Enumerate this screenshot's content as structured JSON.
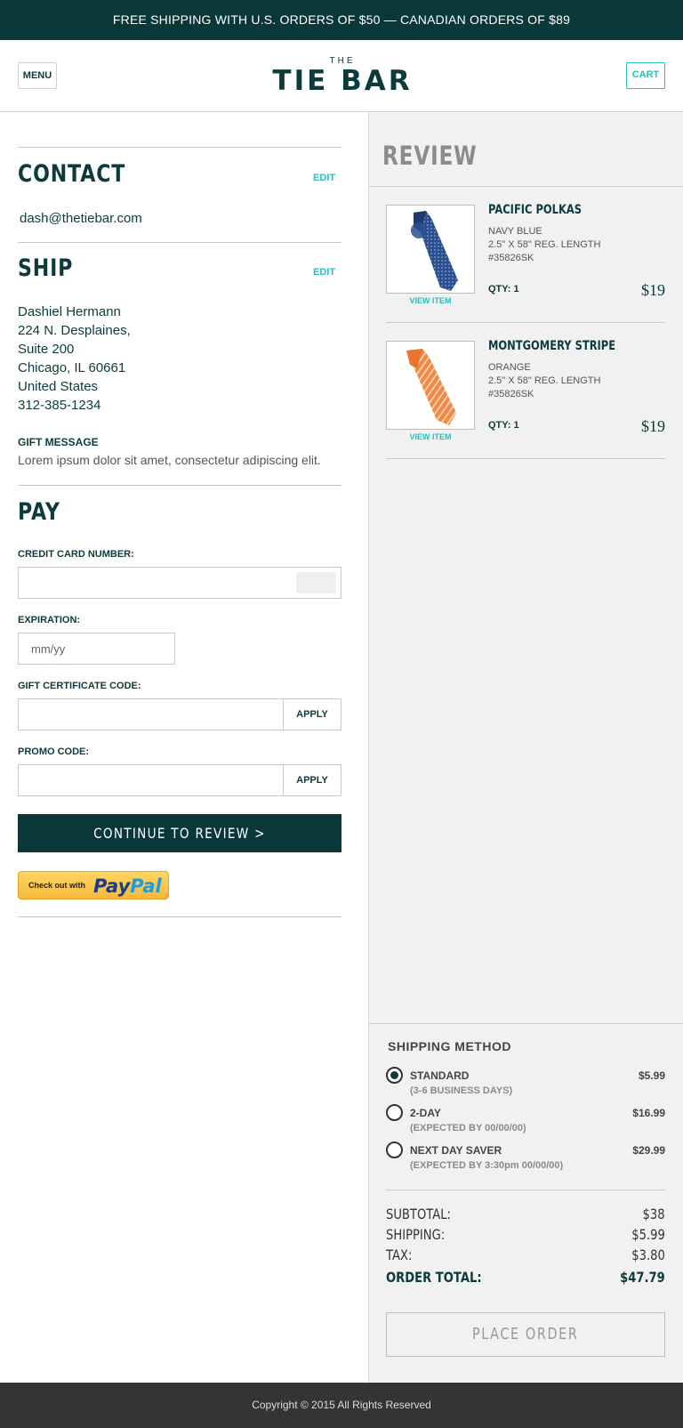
{
  "banner": {
    "text": "FREE SHIPPING WITH U.S. ORDERS OF $50 — CANADIAN ORDERS OF $89"
  },
  "header": {
    "menu_label": "MENU",
    "logo_top": "THE",
    "logo_main": "TIE BAR",
    "cart_label": "CART"
  },
  "contact": {
    "title": "CONTACT",
    "edit_label": "EDIT",
    "email": "dash@thetiebar.com"
  },
  "ship": {
    "title": "SHIP",
    "edit_label": "EDIT",
    "address_lines": [
      "Dashiel Hermann",
      "224 N. Desplaines,",
      "Suite 200",
      "Chicago, IL 60661",
      "United States",
      "312-385-1234"
    ],
    "gift_label": "GIFT MESSAGE",
    "gift_text": "Lorem ipsum dolor sit amet, consectetur adipiscing elit."
  },
  "pay": {
    "title": "PAY",
    "card_label": "CREDIT CARD NUMBER:",
    "card_value": "",
    "exp_label": "EXPIRATION:",
    "exp_placeholder": "mm/yy",
    "gift_cert_label": "GIFT CERTIFICATE CODE:",
    "promo_label": "PROMO CODE:",
    "apply_label": "APPLY",
    "continue_label": "CONTINUE TO REVIEW >",
    "paypal_small": "Check out with",
    "paypal_pay": "Pay",
    "paypal_pal": "Pal"
  },
  "review": {
    "title": "REVIEW",
    "view_item_label": "VIEW ITEM",
    "items": [
      {
        "name": "PACIFIC POLKAS",
        "color": "NAVY BLUE",
        "size": "2.5\" X 58\" REG. LENGTH",
        "sku": "#35826SK",
        "qty": "QTY: 1",
        "price": "$19",
        "tie_color": "#2b4f8e"
      },
      {
        "name": "MONTGOMERY STRIPE",
        "color": "ORANGE",
        "size": "2.5\" X 58\" REG. LENGTH",
        "sku": "#35826SK",
        "qty": "QTY: 1",
        "price": "$19",
        "tie_color": "#f28a45"
      }
    ]
  },
  "shipping": {
    "title": "SHIPPING METHOD",
    "options": [
      {
        "name": "STANDARD",
        "sub": "(3-6 BUSINESS DAYS)",
        "price": "$5.99",
        "selected": true
      },
      {
        "name": "2-DAY",
        "sub": "(EXPECTED BY 00/00/00)",
        "price": "$16.99",
        "selected": false
      },
      {
        "name": "NEXT DAY SAVER",
        "sub": "(EXPECTED BY 3:30pm 00/00/00)",
        "price": "$29.99",
        "selected": false
      }
    ]
  },
  "summary": {
    "subtotal_label": "SUBTOTAL:",
    "subtotal": "$38",
    "shipping_label": "SHIPPING:",
    "shipping": "$5.99",
    "tax_label": "TAX:",
    "tax": "$3.80",
    "total_label": "ORDER TOTAL:",
    "total": "$47.79"
  },
  "place_order_label": "PLACE ORDER",
  "footer": {
    "text": "Copyright © 2015 All Rights Reserved"
  },
  "colors": {
    "primary": "#0a3838",
    "accent": "#27c0c0",
    "panel": "#f1f1f1"
  }
}
